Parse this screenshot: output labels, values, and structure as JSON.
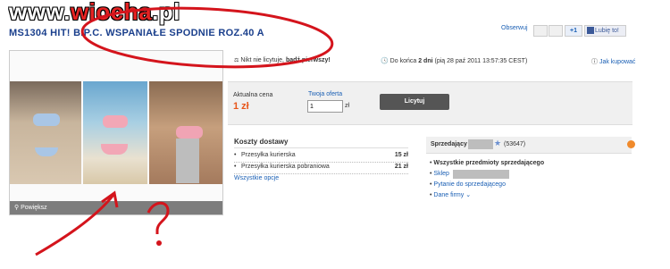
{
  "watermark": {
    "part1": "www.",
    "part2": "wiocha",
    "part3": ".pl"
  },
  "auction": {
    "title": "MS1304 HIT! B.P.C. WSPANIAŁE SPODNIE ROZ.40 A"
  },
  "social": {
    "observe": "Obserwuj",
    "gplus": "+1",
    "like": "Lubię to!"
  },
  "photo": {
    "zoom_label": "Powiększ"
  },
  "bids": {
    "no_bids_prefix": "Nikt nie licytuje,",
    "no_bids_bold": "bądź pierwszy!"
  },
  "time": {
    "prefix": "Do końca",
    "bold": "2 dni",
    "rest": "(pią 28 paź 2011 13:57:35 CEST)"
  },
  "help": {
    "label": "Jak kupować"
  },
  "price": {
    "label": "Aktualna cena",
    "value": "1 zł"
  },
  "offer": {
    "label": "Twoja oferta",
    "value": "1",
    "unit": "zł"
  },
  "bid_button": "Licytuj",
  "shipping": {
    "title": "Koszty dostawy",
    "items": [
      {
        "name": "Przesyłka kurierska",
        "price": "15 zł"
      },
      {
        "name": "Przesyłka kurierska pobraniowa",
        "price": "21 zł"
      }
    ],
    "all_options": "Wszystkie opcje"
  },
  "seller": {
    "label": "Sprzedający",
    "rating": "(53647)",
    "all_items": "Wszystkie przedmioty sprzedającego",
    "shop": "Sklep",
    "ask": "Pytanie do sprzedającego",
    "company": "Dane firmy"
  },
  "colors": {
    "accent": "#1a5fb4",
    "price": "#e8561b",
    "annotation": "#d4141c"
  }
}
